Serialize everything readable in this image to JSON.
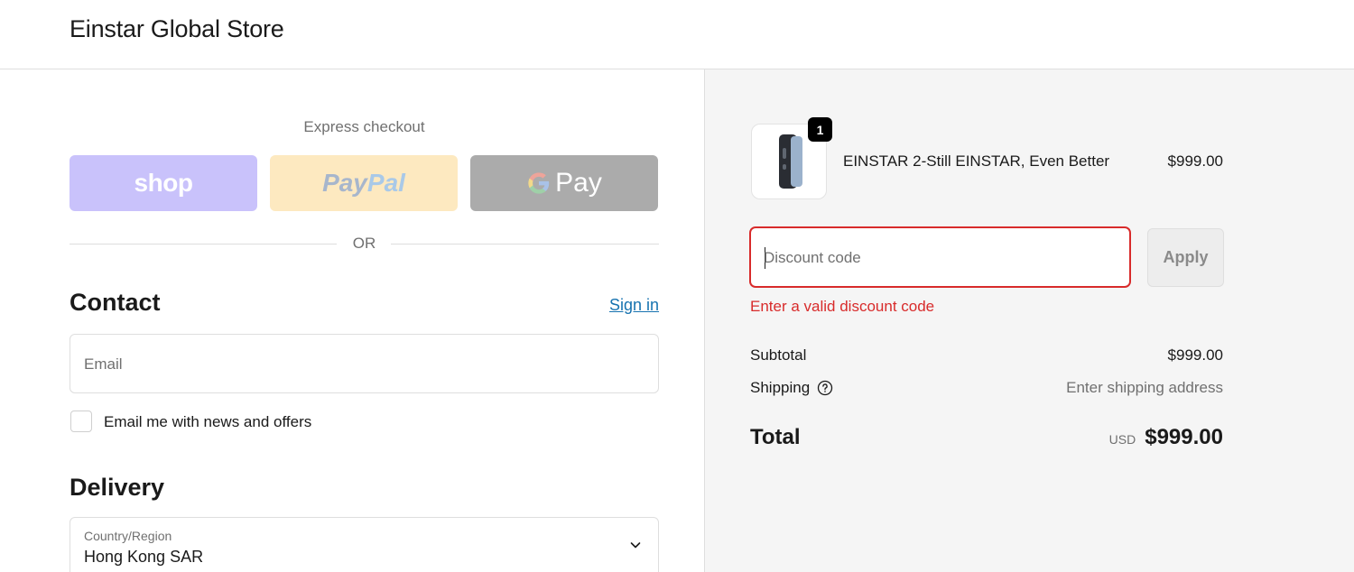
{
  "header": {
    "store_name": "Einstar Global Store"
  },
  "express": {
    "label": "Express checkout",
    "shop_label": "shop",
    "paypal_part1": "Pay",
    "paypal_part2": "Pal",
    "gpay_label": "Pay",
    "or_label": "OR"
  },
  "contact": {
    "title": "Contact",
    "sign_in": "Sign in",
    "email_placeholder": "Email",
    "news_label": "Email me with news and offers"
  },
  "delivery": {
    "title": "Delivery",
    "country_label": "Country/Region",
    "country_value": "Hong Kong SAR"
  },
  "order": {
    "quantity": "1",
    "product_name": "EINSTAR 2-Still EINSTAR, Even Better",
    "product_price": "$999.00",
    "discount_placeholder": "Discount code",
    "apply_label": "Apply",
    "discount_error": "Enter a valid discount code",
    "subtotal_label": "Subtotal",
    "subtotal_value": "$999.00",
    "shipping_label": "Shipping",
    "shipping_value": "Enter shipping address",
    "total_label": "Total",
    "total_currency": "USD",
    "total_value": "$999.00"
  },
  "colors": {
    "error": "#d82b2b",
    "link": "#1773b0",
    "shop_button": "#c9c2fb",
    "paypal_button": "#fde9c0",
    "gpay_button": "#ababab"
  }
}
